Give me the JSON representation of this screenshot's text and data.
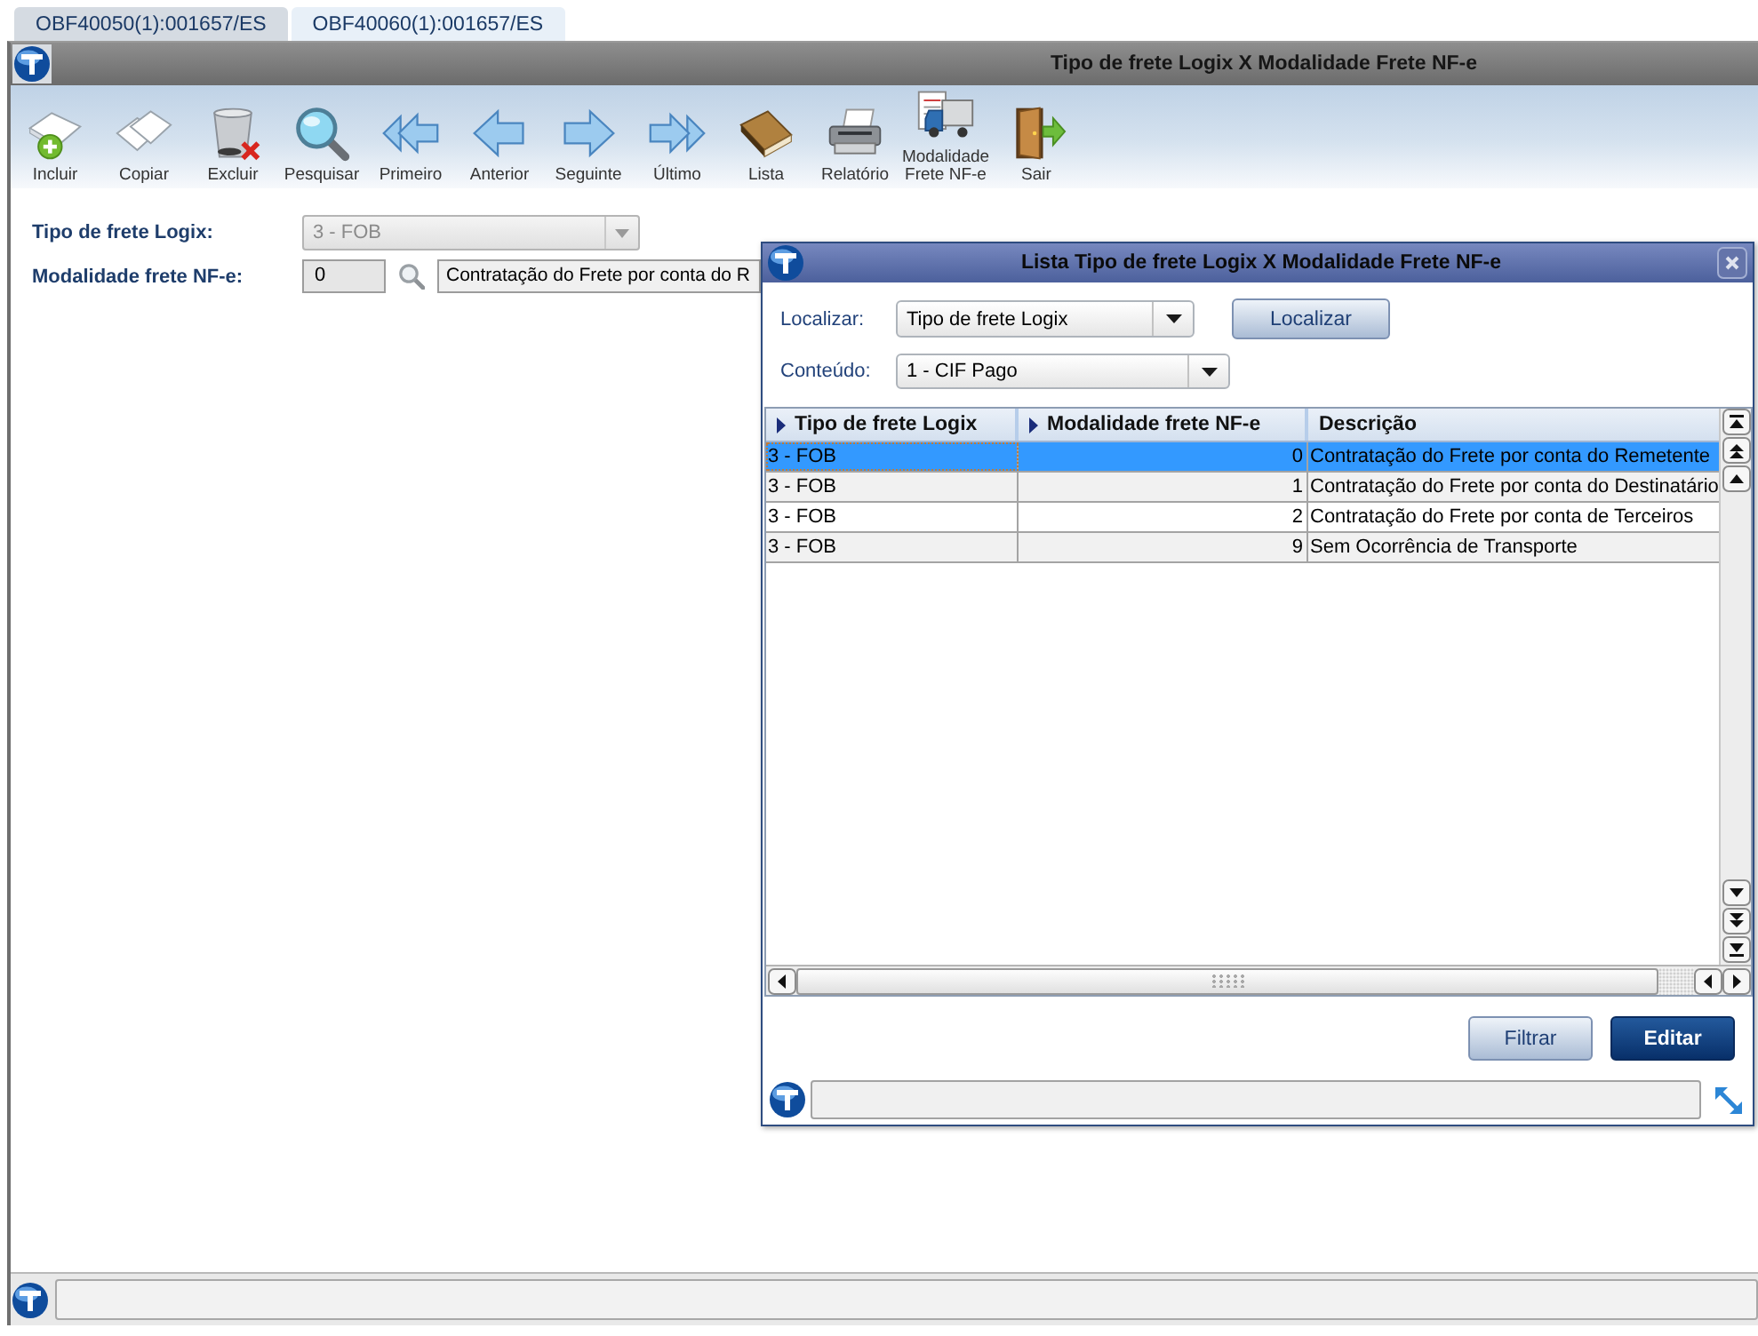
{
  "tabs": [
    {
      "label": "OBF40050(1):001657/ES",
      "selected": false
    },
    {
      "label": "OBF40060(1):001657/ES",
      "selected": true
    }
  ],
  "window": {
    "title": "Tipo de frete Logix X Modalidade Frete NF-e"
  },
  "toolbar": [
    {
      "label": "Incluir",
      "kind": "add"
    },
    {
      "label": "Copiar",
      "kind": "copy"
    },
    {
      "label": "Excluir",
      "kind": "delete"
    },
    {
      "label": "Pesquisar",
      "kind": "search"
    },
    {
      "label": "Primeiro",
      "kind": "first"
    },
    {
      "label": "Anterior",
      "kind": "previous"
    },
    {
      "label": "Seguinte",
      "kind": "next"
    },
    {
      "label": "Último",
      "kind": "last"
    },
    {
      "label": "Lista",
      "kind": "list"
    },
    {
      "label": "Relatório",
      "kind": "report"
    },
    {
      "label": "Modalidade Frete NF-e",
      "kind": "freight"
    },
    {
      "label": "Sair",
      "kind": "exit"
    }
  ],
  "form": {
    "fields": [
      {
        "kind": "dropdown",
        "label": "Tipo de frete Logix:",
        "value": "3 - FOB",
        "disabled": true
      },
      {
        "kind": "lookup",
        "label": "Modalidade frete NF-e:",
        "code": "0",
        "description": "Contratação do Frete por conta do R"
      }
    ]
  },
  "dialog": {
    "title": "Lista Tipo de frete Logix X Modalidade Frete NF-e",
    "filters": [
      {
        "label": "Localizar:",
        "value": "Tipo de frete Logix",
        "button": "Localizar"
      },
      {
        "label": "Conteúdo:",
        "value": "1 - CIF Pago"
      }
    ],
    "table": {
      "columns": [
        {
          "label": "Tipo de frete Logix",
          "kind": "text",
          "sort_arrow": true
        },
        {
          "label": "Modalidade frete NF-e",
          "kind": "number",
          "sort_arrow": true
        },
        {
          "label": "Descrição",
          "kind": "text",
          "sort_arrow": false
        }
      ],
      "rows": [
        {
          "cells": [
            "3 - FOB",
            "0",
            "Contratação do Frete por conta do Remetente"
          ],
          "selected": true
        },
        {
          "cells": [
            "3 - FOB",
            "1",
            "Contratação do Frete por conta do Destinatário"
          ],
          "selected": false
        },
        {
          "cells": [
            "3 - FOB",
            "2",
            "Contratação do Frete por conta de Terceiros"
          ],
          "selected": false
        },
        {
          "cells": [
            "3 - FOB",
            "9",
            "Sem Ocorrência de Transporte"
          ],
          "selected": false
        }
      ]
    },
    "buttons": [
      {
        "label": "Filtrar",
        "kind": "secondary"
      },
      {
        "label": "Editar",
        "kind": "primary"
      }
    ]
  }
}
